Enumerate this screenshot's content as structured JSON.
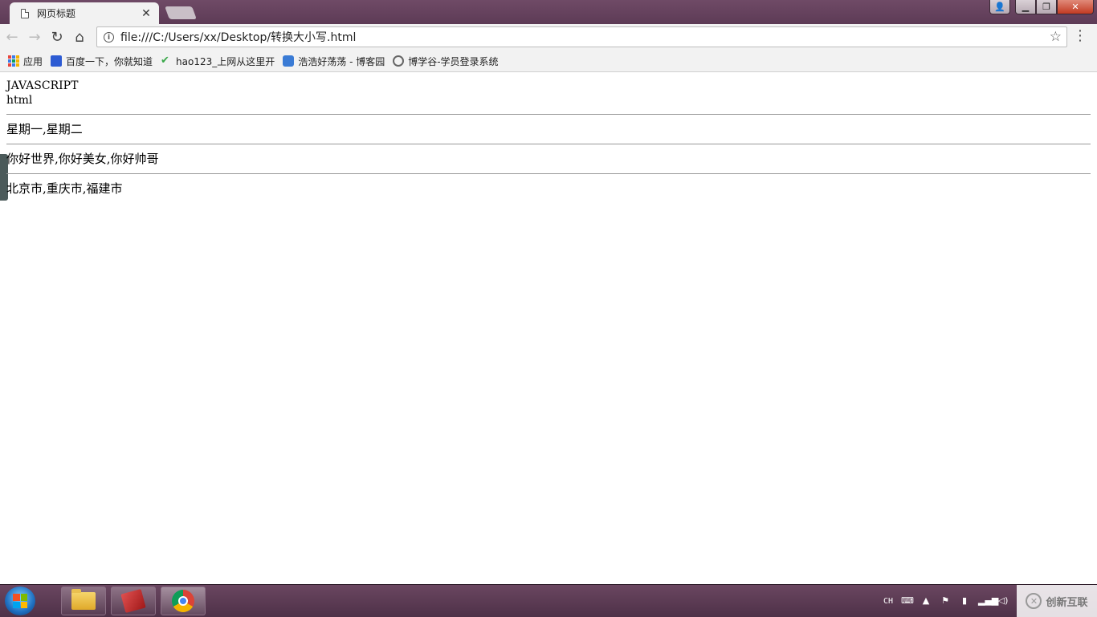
{
  "browser": {
    "tab": {
      "title": "网页标题",
      "close": "✕"
    },
    "window_buttons": {
      "user": "👤",
      "minimize": "▁",
      "maximize": "❐",
      "close": "✕"
    },
    "nav": {
      "back": "←",
      "forward": "→",
      "reload": "↻",
      "home": "⌂"
    },
    "address_bar": {
      "info": "i",
      "url": "file:///C:/Users/xx/Desktop/转换大小写.html",
      "star": "☆"
    },
    "menu": "⋮",
    "bookmarks": [
      {
        "label": "应用",
        "icon": "apps-grid-icon"
      },
      {
        "label": "百度一下，你就知道",
        "icon": "baidu-paw-icon"
      },
      {
        "label": "hao123_上网从这里开",
        "icon": "hao123-icon"
      },
      {
        "label": "浩浩好荡荡 - 博客园",
        "icon": "cnblogs-icon"
      },
      {
        "label": "博学谷-学员登录系统",
        "icon": "boxuegu-icon"
      }
    ]
  },
  "content": {
    "line1": "JAVASCRIPT",
    "line2": "html",
    "row1": "星期一,星期二",
    "row2": "你好世界,你好美女,你好帅哥",
    "row3": "北京市,重庆市,福建市"
  },
  "taskbar": {
    "tray_lang": "CH",
    "watermark": "创新互联"
  }
}
